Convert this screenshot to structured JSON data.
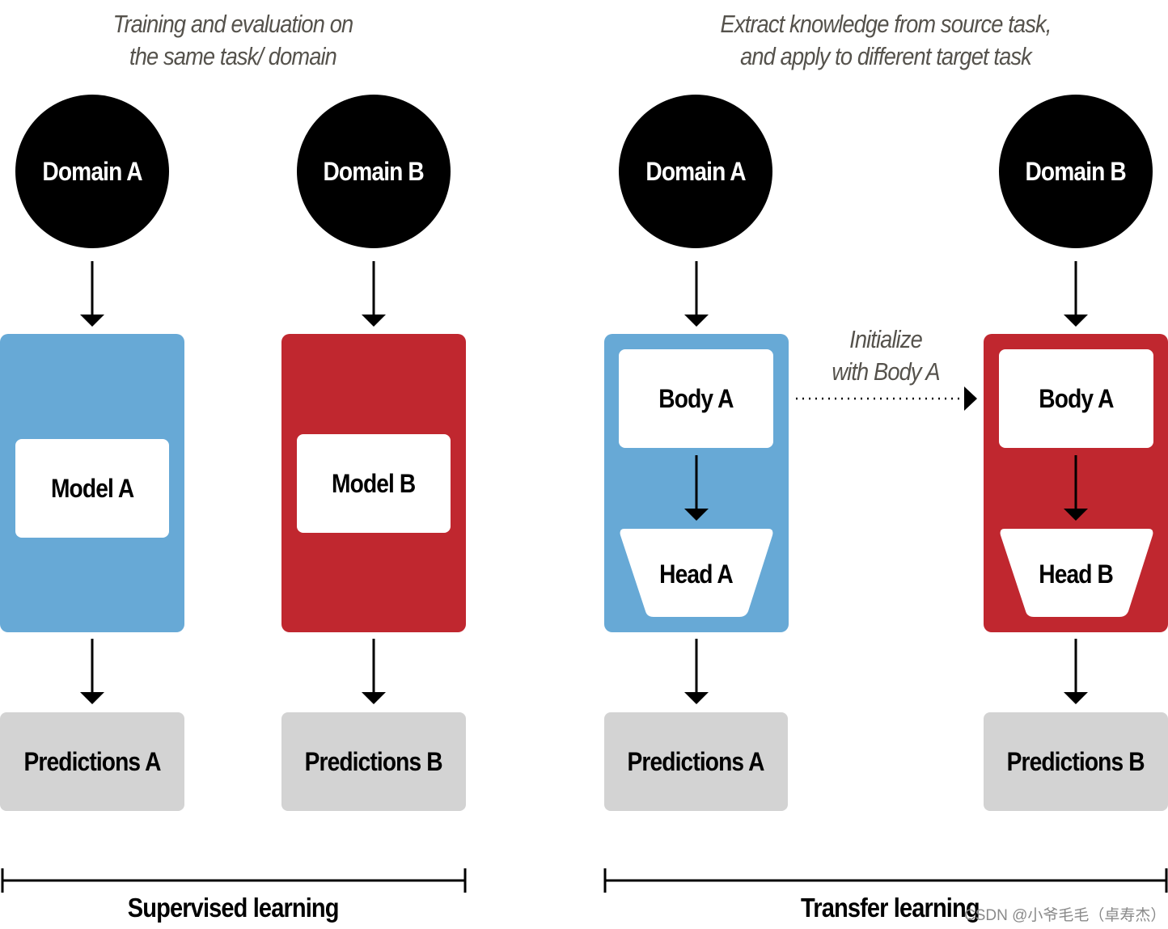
{
  "supervised": {
    "caption_line1": "Training and evaluation on",
    "caption_line2": "the same task/ domain",
    "domain_a": "Domain A",
    "domain_b": "Domain B",
    "model_a": "Model A",
    "model_b": "Model B",
    "predictions_a": "Predictions A",
    "predictions_b": "Predictions B",
    "label": "Supervised learning"
  },
  "transfer": {
    "caption_line1": "Extract knowledge from source task,",
    "caption_line2": "and apply to  different target task",
    "domain_a": "Domain A",
    "domain_b": "Domain B",
    "body_a": "Body A",
    "head_a": "Head A",
    "body_b": "Body A",
    "head_b": "Head B",
    "init_line1": "Initialize",
    "init_line2": "with Body A",
    "predictions_a": "Predictions A",
    "predictions_b": "Predictions B",
    "label": "Transfer learning"
  },
  "colors": {
    "domain_a_panel": "#67a9d6",
    "domain_b_panel": "#c0272f",
    "prediction_box": "#d3d3d3",
    "domain_circle": "#000000"
  },
  "watermark": "CSDN @小爷毛毛（卓寿杰）"
}
